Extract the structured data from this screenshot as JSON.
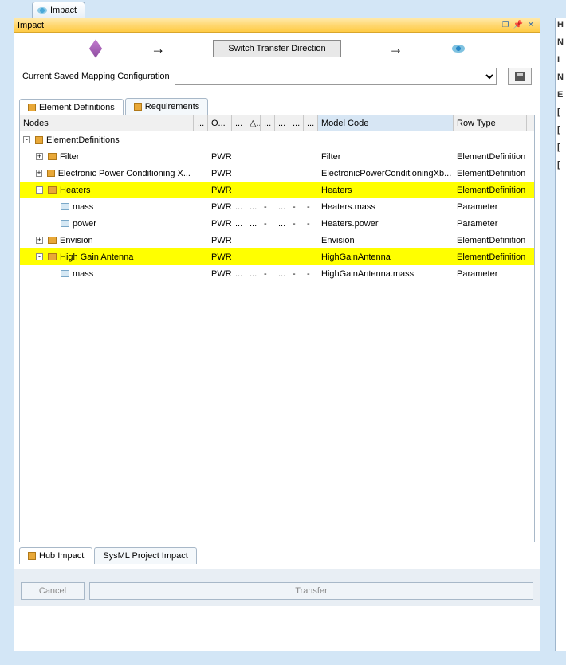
{
  "tab": {
    "label": "Impact"
  },
  "titlebar": {
    "title": "Impact"
  },
  "toolbar": {
    "switch_label": "Switch Transfer Direction"
  },
  "config": {
    "label": "Current Saved Mapping Configuration",
    "value": ""
  },
  "inner_tabs": [
    {
      "label": "Element Definitions",
      "active": true
    },
    {
      "label": "Requirements",
      "active": false
    }
  ],
  "grid": {
    "headers": {
      "nodes": "Nodes",
      "dot1": "...",
      "o": "O...",
      "dot2": "...",
      "tri": "△...",
      "dot3": "...",
      "dot4": "...",
      "dot5": "...",
      "dot6": "...",
      "model": "Model Code",
      "type": "Row Type"
    },
    "rows": [
      {
        "indent": 0,
        "toggle": "-",
        "icon": "pkg",
        "label": "ElementDefinitions",
        "o": "",
        "dots": [
          "",
          "",
          "",
          "",
          "",
          ""
        ],
        "model": "",
        "type": "",
        "hl": false
      },
      {
        "indent": 1,
        "toggle": "+",
        "icon": "folder",
        "label": "Filter",
        "o": "PWR",
        "dots": [
          "",
          "",
          "",
          "",
          "",
          ""
        ],
        "model": "Filter",
        "type": "ElementDefinition",
        "hl": false
      },
      {
        "indent": 1,
        "toggle": "+",
        "icon": "folder",
        "label": "Electronic Power Conditioning X...",
        "o": "PWR",
        "dots": [
          "",
          "",
          "",
          "",
          "",
          ""
        ],
        "model": "ElectronicPowerConditioningXb...",
        "type": "ElementDefinition",
        "hl": false
      },
      {
        "indent": 1,
        "toggle": "-",
        "icon": "folder",
        "label": "Heaters",
        "o": "PWR",
        "dots": [
          "",
          "",
          "",
          "",
          "",
          ""
        ],
        "model": "Heaters",
        "type": "ElementDefinition",
        "hl": true
      },
      {
        "indent": 2,
        "toggle": "",
        "icon": "prop",
        "label": "mass",
        "o": "PWR",
        "dots": [
          "...",
          "...",
          "-",
          "...",
          "-",
          "-"
        ],
        "model": "Heaters.mass",
        "type": "Parameter",
        "hl": false
      },
      {
        "indent": 2,
        "toggle": "",
        "icon": "prop",
        "label": "power",
        "o": "PWR",
        "dots": [
          "...",
          "...",
          "-",
          "...",
          "-",
          "-"
        ],
        "model": "Heaters.power",
        "type": "Parameter",
        "hl": false
      },
      {
        "indent": 1,
        "toggle": "+",
        "icon": "folder",
        "label": "Envision",
        "o": "PWR",
        "dots": [
          "",
          "",
          "",
          "",
          "",
          ""
        ],
        "model": "Envision",
        "type": "ElementDefinition",
        "hl": false
      },
      {
        "indent": 1,
        "toggle": "-",
        "icon": "folder",
        "label": "High Gain Antenna",
        "o": "PWR",
        "dots": [
          "",
          "",
          "",
          "",
          "",
          ""
        ],
        "model": "HighGainAntenna",
        "type": "ElementDefinition",
        "hl": true
      },
      {
        "indent": 2,
        "toggle": "",
        "icon": "prop",
        "label": "mass",
        "o": "PWR",
        "dots": [
          "...",
          "...",
          "-",
          "...",
          "-",
          "-"
        ],
        "model": "HighGainAntenna.mass",
        "type": "Parameter",
        "hl": false
      }
    ]
  },
  "bottom_tabs": [
    {
      "label": "Hub Impact",
      "active": true
    },
    {
      "label": "SysML Project Impact",
      "active": false
    }
  ],
  "footer": {
    "cancel": "Cancel",
    "transfer": "Transfer"
  }
}
